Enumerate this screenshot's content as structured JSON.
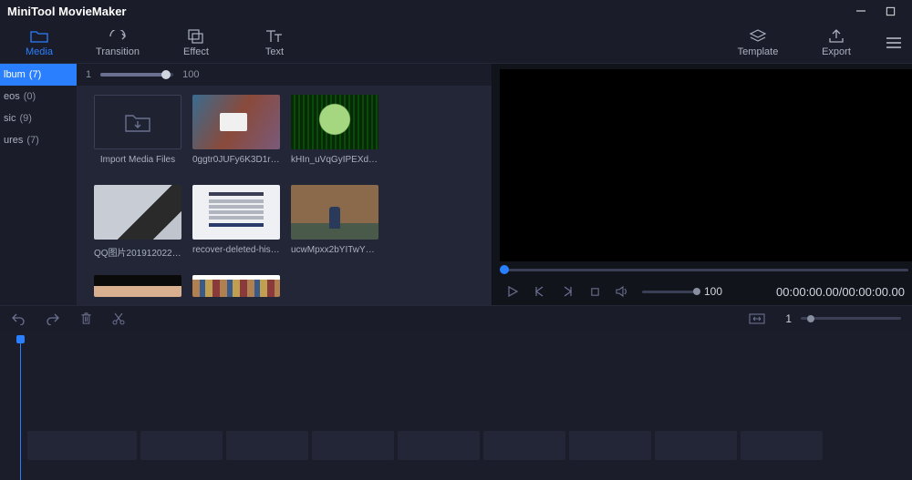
{
  "app": {
    "title": "MiniTool MovieMaker"
  },
  "toolbar": {
    "media": "Media",
    "transition": "Transition",
    "effect": "Effect",
    "text": "Text",
    "template": "Template",
    "export": "Export"
  },
  "sidebar": {
    "items": [
      {
        "label": "lbum",
        "count": "(7)"
      },
      {
        "label": "eos",
        "count": "(0)"
      },
      {
        "label": "sic",
        "count": "(9)"
      },
      {
        "label": "ures",
        "count": "(7)"
      }
    ]
  },
  "thumb_slider": {
    "min": "1",
    "max": "100",
    "pct": 90
  },
  "media": {
    "import_label": "Import Media Files",
    "items": [
      {
        "label": "0ggtr0JUFy6K3D1r_9aS..."
      },
      {
        "label": "kHIn_uVqGyIPEXd6D..."
      },
      {
        "label": "QQ图片20191202215506"
      },
      {
        "label": "recover-deleted-histor..."
      },
      {
        "label": "ucwMpxx2bYITwY7rZ..."
      }
    ]
  },
  "player": {
    "volume": "100",
    "timecode": "00:00:00.00/00:00:00.00"
  },
  "timeline": {
    "zoom": "1",
    "blocks": [
      120,
      90,
      90,
      90,
      90,
      90,
      90,
      90,
      90
    ]
  }
}
